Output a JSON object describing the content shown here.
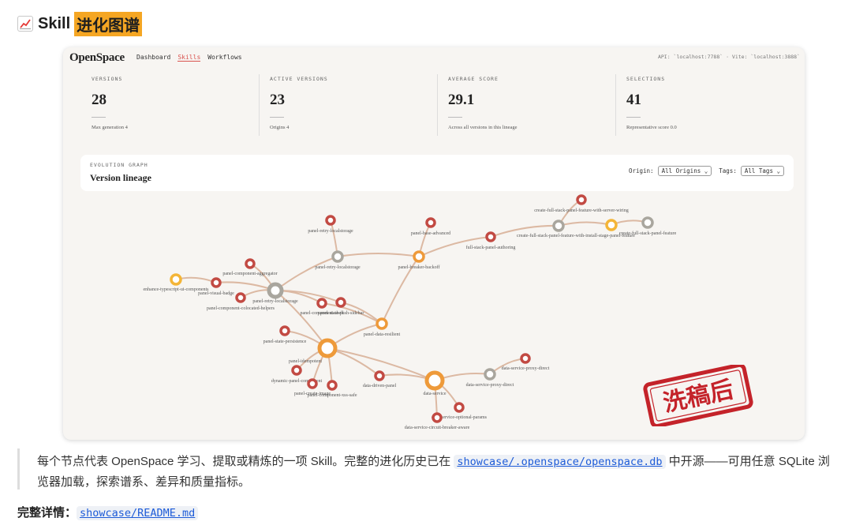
{
  "heading": {
    "prefix": "Skill",
    "highlight": "进化图谱",
    "icon": "chart-increasing-emoji"
  },
  "app": {
    "brand": "OpenSpace",
    "nav": [
      "Dashboard",
      "Skills",
      "Workflows"
    ],
    "nav_active": "Skills",
    "api_info": "API: `localhost:7788` · Vite: `localhost:3888`"
  },
  "stats": [
    {
      "label": "VERSIONS",
      "value": "28",
      "sub": "Max generation 4"
    },
    {
      "label": "ACTIVE VERSIONS",
      "value": "23",
      "sub": "Origins 4"
    },
    {
      "label": "AVERAGE SCORE",
      "value": "29.1",
      "sub": "Across all versions in this lineage"
    },
    {
      "label": "SELECTIONS",
      "value": "41",
      "sub": "Representative score 0.0"
    }
  ],
  "graph": {
    "section_label": "EVOLUTION GRAPH",
    "title": "Version lineage",
    "origin_label": "Origin:",
    "origin_value": "All Origins",
    "tags_label": "Tags:",
    "tags_value": "All Tags",
    "colors": {
      "red": "#c24a43",
      "orange": "#ee9a3a",
      "yellow": "#f4b537",
      "gray": "#a9a69e",
      "edge": "#dcb9a3"
    },
    "node_labels": {
      "n1": "panel-retry-localstorage",
      "n2": "panel-base-advanced",
      "n3": "create-full-stack-panel-feature-with-server-wiring",
      "n6": "create-full-stack-panel-feature-with-install-stage-panel-feature",
      "n7": "create-full-stack-panel-feature",
      "n8": "full-stack-panel-authoring",
      "n9": "panel-breaker-backoff",
      "n10": "panel-retry-localstorage",
      "n11": "panel-component-aggregator",
      "n12": "enhance-typescript-ui-components",
      "n13": "panel-visual-badge",
      "n14": "panel-retry-localstorage",
      "n15": "panel-component-colocated-helpers",
      "n16": "panel-component-shell",
      "n17": "panel-state-push-sidebar",
      "n18": "panel-data-resilient",
      "n19": "panel-state-persistence",
      "n20": "panel-idempotent",
      "n21": "dynamic-panel-component",
      "n22": "panel-create-image",
      "n23": "panel-component-xss-safe",
      "n24": "data-driven-panel",
      "n25": "data-service",
      "n26": "data-service-proxy-direct",
      "n27": "data-service-proxy-direct",
      "n28": "data-service-optional-params",
      "n29": "data-service-circuit-breaker-aware"
    }
  },
  "stamp": {
    "text": "洗稿后",
    "color": "#c4232a"
  },
  "quote": {
    "before": "每个节点代表 OpenSpace 学习、提取或精炼的一项 Skill。完整的进化历史已在 ",
    "code": "showcase/.openspace/openspace.db",
    "after": " 中开源——可用任意 SQLite 浏览器加载，探索谱系、差异和质量指标。"
  },
  "detail": {
    "label": "完整详情：",
    "code": "showcase/README.md"
  }
}
